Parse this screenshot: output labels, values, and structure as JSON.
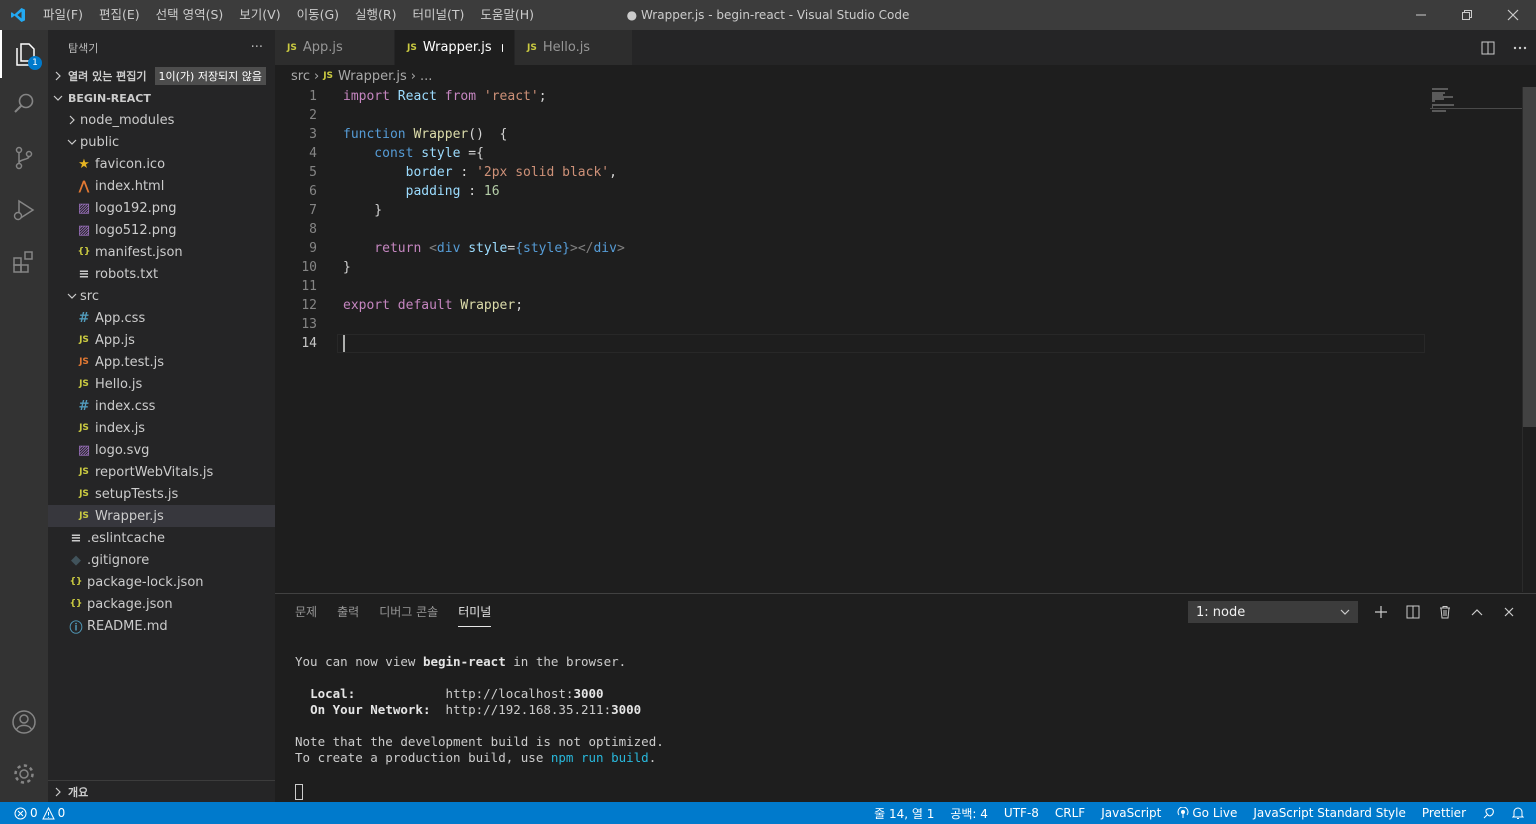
{
  "window": {
    "title": "● Wrapper.js - begin-react - Visual Studio Code",
    "menu": [
      "파일(F)",
      "편집(E)",
      "선택 영역(S)",
      "보기(V)",
      "이동(G)",
      "실행(R)",
      "터미널(T)",
      "도움말(H)"
    ]
  },
  "activity": {
    "explorer_badge": "1"
  },
  "sidebar": {
    "header": "탐색기",
    "more": "···",
    "open_editors": {
      "label": "열려 있는 편집기",
      "badge": "1이(가) 저장되지 않음"
    },
    "project": "BEGIN-REACT",
    "tree": [
      {
        "name": "node_modules",
        "kind": "folder-closed",
        "depth": 1
      },
      {
        "name": "public",
        "kind": "folder-open",
        "depth": 1
      },
      {
        "name": "favicon.ico",
        "kind": "favicon",
        "depth": 2
      },
      {
        "name": "index.html",
        "kind": "html",
        "depth": 2
      },
      {
        "name": "logo192.png",
        "kind": "image",
        "depth": 2
      },
      {
        "name": "logo512.png",
        "kind": "image",
        "depth": 2
      },
      {
        "name": "manifest.json",
        "kind": "json",
        "depth": 2
      },
      {
        "name": "robots.txt",
        "kind": "text",
        "depth": 2
      },
      {
        "name": "src",
        "kind": "folder-open",
        "depth": 1
      },
      {
        "name": "App.css",
        "kind": "css",
        "depth": 2
      },
      {
        "name": "App.js",
        "kind": "js",
        "depth": 2
      },
      {
        "name": "App.test.js",
        "kind": "test",
        "depth": 2
      },
      {
        "name": "Hello.js",
        "kind": "js",
        "depth": 2
      },
      {
        "name": "index.css",
        "kind": "css",
        "depth": 2
      },
      {
        "name": "index.js",
        "kind": "js",
        "depth": 2
      },
      {
        "name": "logo.svg",
        "kind": "svg",
        "depth": 2
      },
      {
        "name": "reportWebVitals.js",
        "kind": "js",
        "depth": 2
      },
      {
        "name": "setupTests.js",
        "kind": "js",
        "depth": 2
      },
      {
        "name": "Wrapper.js",
        "kind": "js",
        "depth": 2,
        "selected": true
      },
      {
        "name": ".eslintcache",
        "kind": "text",
        "depth": 1
      },
      {
        "name": ".gitignore",
        "kind": "git",
        "depth": 1
      },
      {
        "name": "package-lock.json",
        "kind": "json",
        "depth": 1
      },
      {
        "name": "package.json",
        "kind": "json",
        "depth": 1
      },
      {
        "name": "README.md",
        "kind": "info",
        "depth": 1
      }
    ],
    "outline": "개요"
  },
  "tabs": [
    {
      "label": "App.js",
      "icon": "JS",
      "active": false
    },
    {
      "label": "Wrapper.js",
      "icon": "JS",
      "active": true,
      "dirty": true
    },
    {
      "label": "Hello.js",
      "icon": "JS",
      "active": false
    }
  ],
  "breadcrumb": {
    "folder": "src",
    "file": "Wrapper.js",
    "more": "..."
  },
  "editor": {
    "current_line": 14,
    "lines": [
      [
        {
          "t": "import ",
          "c": "ctrl"
        },
        {
          "t": "React ",
          "c": "var"
        },
        {
          "t": "from ",
          "c": "ctrl"
        },
        {
          "t": "'react'",
          "c": "str"
        },
        {
          "t": ";",
          "c": "plain"
        }
      ],
      [],
      [
        {
          "t": "function ",
          "c": "kw"
        },
        {
          "t": "Wrapper",
          "c": "fn"
        },
        {
          "t": "()  {",
          "c": "plain"
        }
      ],
      [
        {
          "t": "    const ",
          "c": "kw"
        },
        {
          "t": "style ",
          "c": "var"
        },
        {
          "t": "={",
          "c": "plain"
        }
      ],
      [
        {
          "t": "        border ",
          "c": "var"
        },
        {
          "t": ": ",
          "c": "plain"
        },
        {
          "t": "'2px solid black'",
          "c": "str"
        },
        {
          "t": ",",
          "c": "plain"
        }
      ],
      [
        {
          "t": "        padding ",
          "c": "var"
        },
        {
          "t": ": ",
          "c": "plain"
        },
        {
          "t": "16",
          "c": "num"
        }
      ],
      [
        {
          "t": "    }",
          "c": "plain"
        }
      ],
      [],
      [
        {
          "t": "    return ",
          "c": "ctrl"
        },
        {
          "t": "<",
          "c": "tag"
        },
        {
          "t": "div ",
          "c": "tagname"
        },
        {
          "t": "style",
          "c": "attr"
        },
        {
          "t": "=",
          "c": "plain"
        },
        {
          "t": "{style}",
          "c": "kw"
        },
        {
          "t": "></",
          "c": "tag"
        },
        {
          "t": "div",
          "c": "tagname"
        },
        {
          "t": ">",
          "c": "tag"
        }
      ],
      [
        {
          "t": "}",
          "c": "plain"
        }
      ],
      [],
      [
        {
          "t": "export ",
          "c": "ctrl"
        },
        {
          "t": "default ",
          "c": "ctrl"
        },
        {
          "t": "Wrapper",
          "c": "fn"
        },
        {
          "t": ";",
          "c": "plain"
        }
      ],
      [],
      []
    ]
  },
  "panel": {
    "tabs": [
      "문제",
      "출력",
      "디버그 콘솔",
      "터미널"
    ],
    "active_tab": "터미널",
    "terminal_select": "1: node",
    "terminal_lines": [
      [
        {
          "t": "You can now view "
        },
        {
          "t": "begin-react",
          "c": "bold"
        },
        {
          "t": " in the browser."
        }
      ],
      [],
      [
        {
          "t": "  "
        },
        {
          "t": "Local:",
          "c": "bold"
        },
        {
          "t": "            http://localhost:"
        },
        {
          "t": "3000",
          "c": "bold"
        }
      ],
      [
        {
          "t": "  "
        },
        {
          "t": "On Your Network:",
          "c": "bold"
        },
        {
          "t": "  http://192.168.35.211:"
        },
        {
          "t": "3000",
          "c": "bold"
        }
      ],
      [],
      [
        {
          "t": "Note that the development build is not optimized."
        }
      ],
      [
        {
          "t": "To create a production build, use "
        },
        {
          "t": "npm run build",
          "c": "cyan"
        },
        {
          "t": "."
        }
      ]
    ]
  },
  "statusbar": {
    "errors": "0",
    "warnings": "0",
    "position": "줄 14, 열 1",
    "spaces": "공백: 4",
    "encoding": "UTF-8",
    "eol": "CRLF",
    "language": "JavaScript",
    "golive": "Go Live",
    "linter": "JavaScript Standard Style",
    "formatter": "Prettier"
  },
  "colors": {
    "accent": "#007acc",
    "js_icon": "#cbcb41"
  }
}
